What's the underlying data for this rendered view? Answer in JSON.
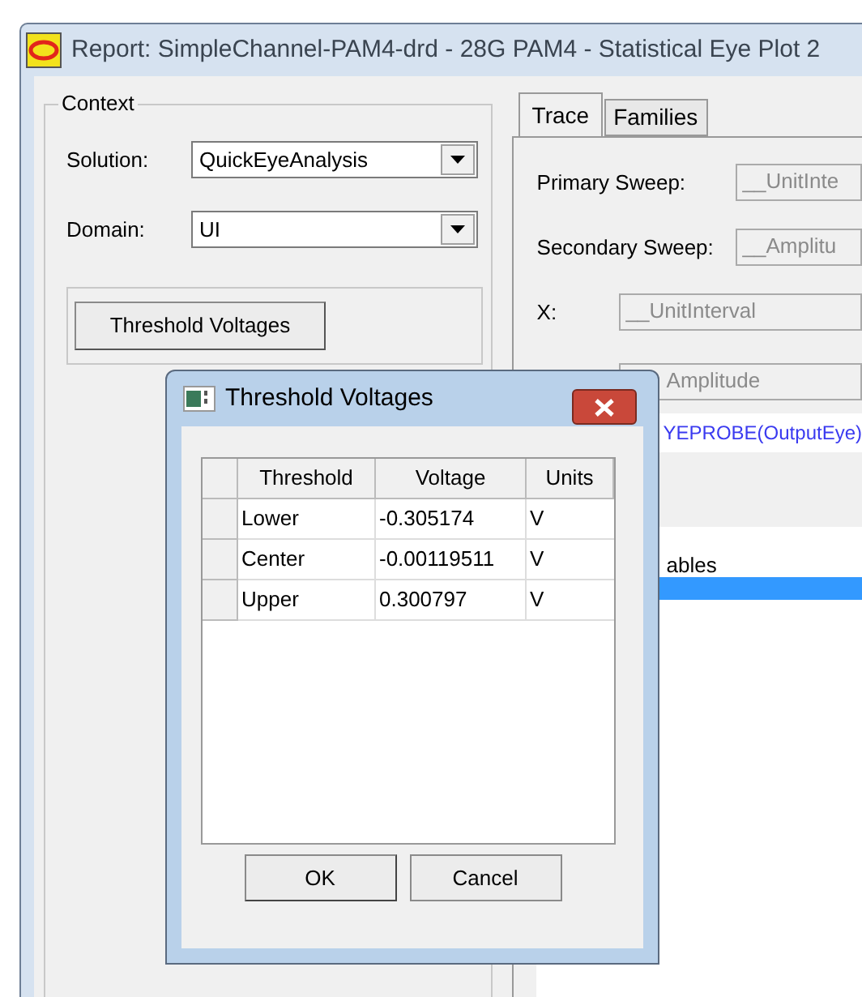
{
  "window": {
    "title": "Report: SimpleChannel-PAM4-drd - 28G PAM4 - Statistical Eye Plot 2"
  },
  "context": {
    "legend": "Context",
    "fields": [
      {
        "label": "Solution:",
        "value": "QuickEyeAnalysis"
      },
      {
        "label": "Domain:",
        "value": "UI"
      }
    ],
    "button": "Threshold Voltages"
  },
  "tabs": [
    {
      "label": "Trace",
      "selected": true
    },
    {
      "label": "Families",
      "selected": false
    }
  ],
  "trace": {
    "sweeps": [
      {
        "label": "Primary Sweep:",
        "value": "__UnitInte"
      },
      {
        "label": "Secondary Sweep:",
        "value": "__Amplitu"
      }
    ],
    "x": {
      "label": "X:",
      "value": "__UnitInterval"
    },
    "y": {
      "value": "Amplitude"
    },
    "expression": "YEPROBE(OutputEye)",
    "list": [
      {
        "text": "ables",
        "selected": false
      },
      {
        "selected": true
      }
    ]
  },
  "dialog": {
    "title": "Threshold Voltages",
    "columns": [
      "Threshold",
      "Voltage",
      "Units"
    ],
    "rows": [
      {
        "threshold": "Lower",
        "voltage": "-0.305174",
        "units": "V"
      },
      {
        "threshold": "Center",
        "voltage": "-0.00119511",
        "units": "V"
      },
      {
        "threshold": "Upper",
        "voltage": "0.300797",
        "units": "V"
      }
    ],
    "buttons": [
      "OK",
      "Cancel"
    ]
  }
}
